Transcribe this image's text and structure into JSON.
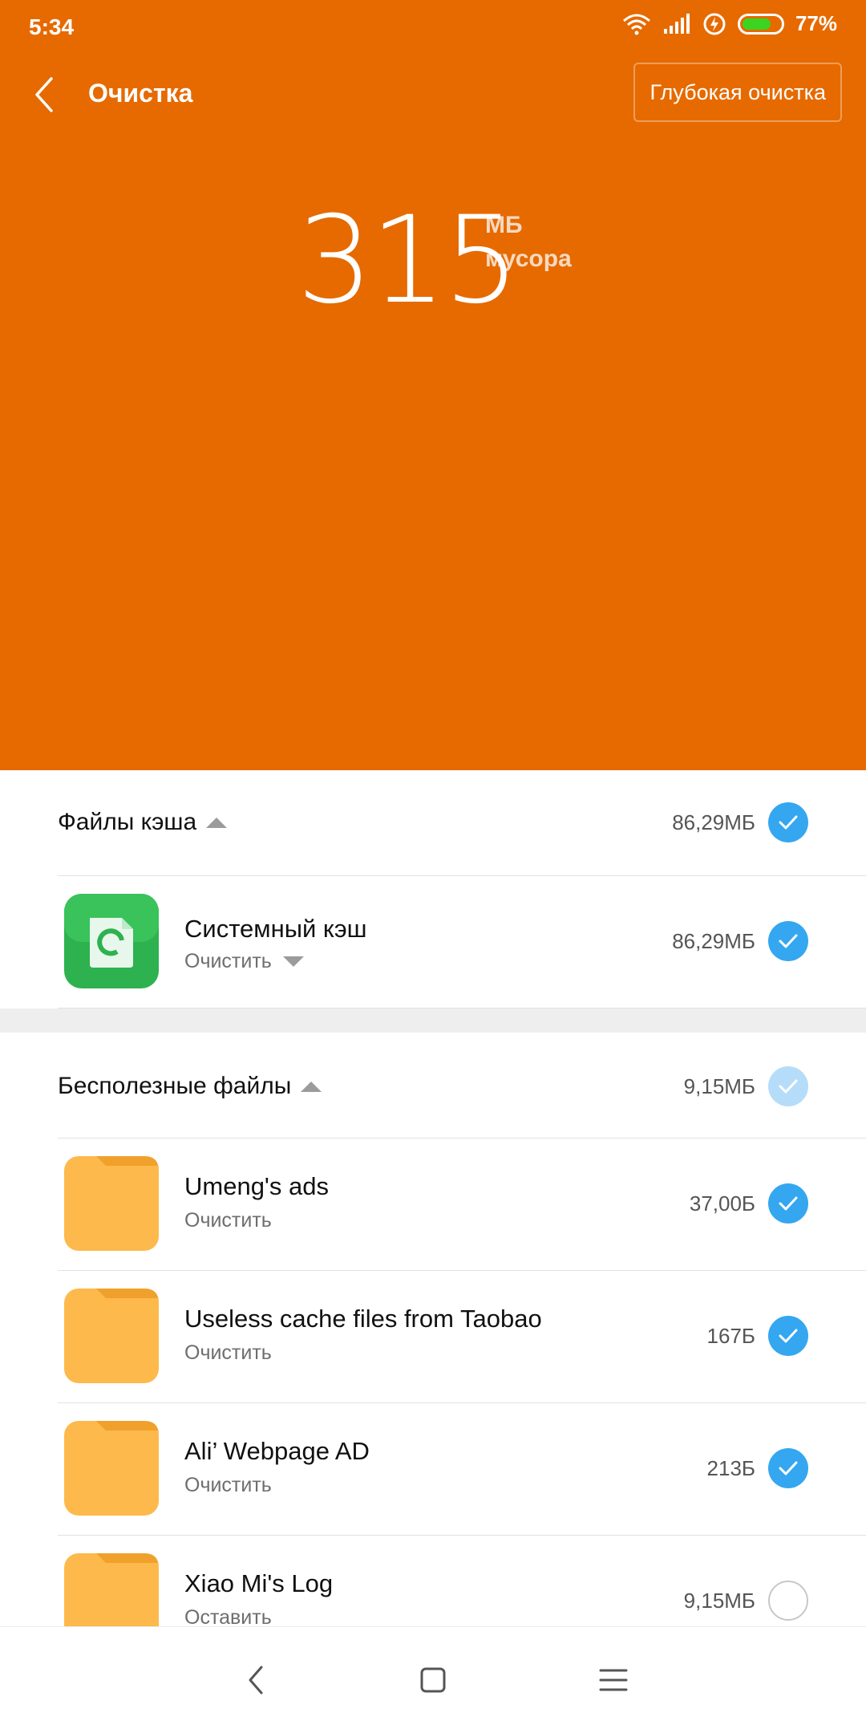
{
  "status_bar": {
    "time": "5:34",
    "battery_percent": "77%",
    "battery_level": 0.77
  },
  "app_bar": {
    "title": "Очистка",
    "deep_clean_label": "Глубокая очистка"
  },
  "junk": {
    "amount": "315",
    "unit": "МБ",
    "label": "мусора"
  },
  "sections": [
    {
      "title": "Файлы кэша",
      "size": "86,29МБ",
      "items": [
        {
          "title": "Системный кэш",
          "action": "Очистить",
          "size": "86,29МБ",
          "checked": true
        }
      ]
    },
    {
      "title": "Бесполезные файлы",
      "size": "9,15МБ",
      "items": [
        {
          "title": "Umeng's ads",
          "action": "Очистить",
          "size": "37,00Б",
          "checked": true
        },
        {
          "title": "Useless cache files from Taobao",
          "action": "Очистить",
          "size": "167Б",
          "checked": true
        },
        {
          "title": "Ali’ Webpage AD",
          "action": "Очистить",
          "size": "213Б",
          "checked": true
        },
        {
          "title": "Xiao Mi's Log",
          "action": "Оставить",
          "size": "9,15МБ",
          "checked": false
        }
      ]
    }
  ],
  "colors": {
    "accent": "#E66A00",
    "check": "#34A7F0",
    "folder": "#FDB94B"
  }
}
